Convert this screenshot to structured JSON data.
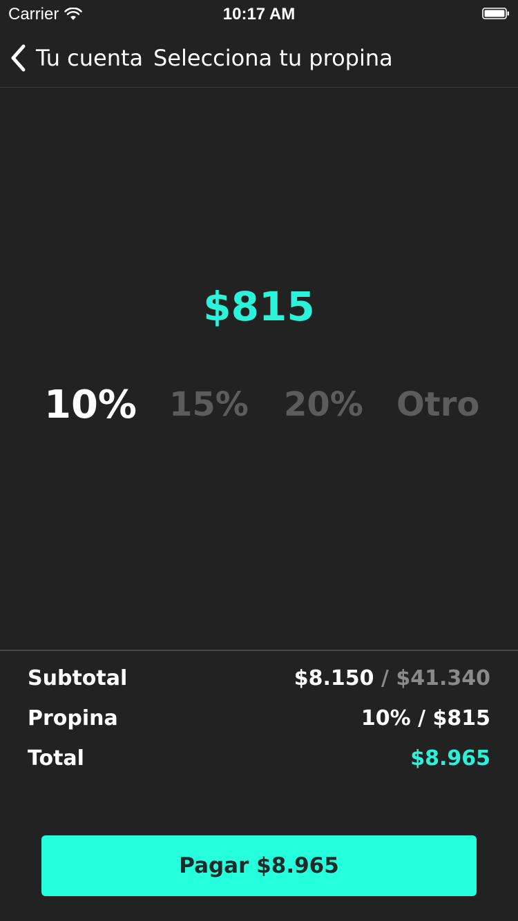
{
  "status_bar": {
    "carrier": "Carrier",
    "time": "10:17 AM",
    "wifi_icon": "wifi-icon",
    "battery_icon": "battery-icon"
  },
  "nav": {
    "back_label": "Tu cuenta",
    "back_icon": "chevron-left-icon",
    "title": "Selecciona tu propina"
  },
  "tip": {
    "amount": "$815",
    "options": [
      {
        "label": "10%",
        "selected": true
      },
      {
        "label": "15%",
        "selected": false
      },
      {
        "label": "20%",
        "selected": false
      },
      {
        "label": "Otro",
        "selected": false
      }
    ]
  },
  "summary": {
    "subtotal_label": "Subtotal",
    "subtotal_value": "$8.150",
    "subtotal_separator": " / ",
    "subtotal_total": "$41.340",
    "tip_label": "Propina",
    "tip_value": "10% / $815",
    "total_label": "Total",
    "total_value": "$8.965"
  },
  "pay_button": {
    "label": "Pagar $8.965"
  },
  "colors": {
    "background": "#222222",
    "accent": "#26ffdd",
    "accent_text": "#2cf2da",
    "inactive_option": "#5c5c5c",
    "muted": "#8a8a8a"
  }
}
